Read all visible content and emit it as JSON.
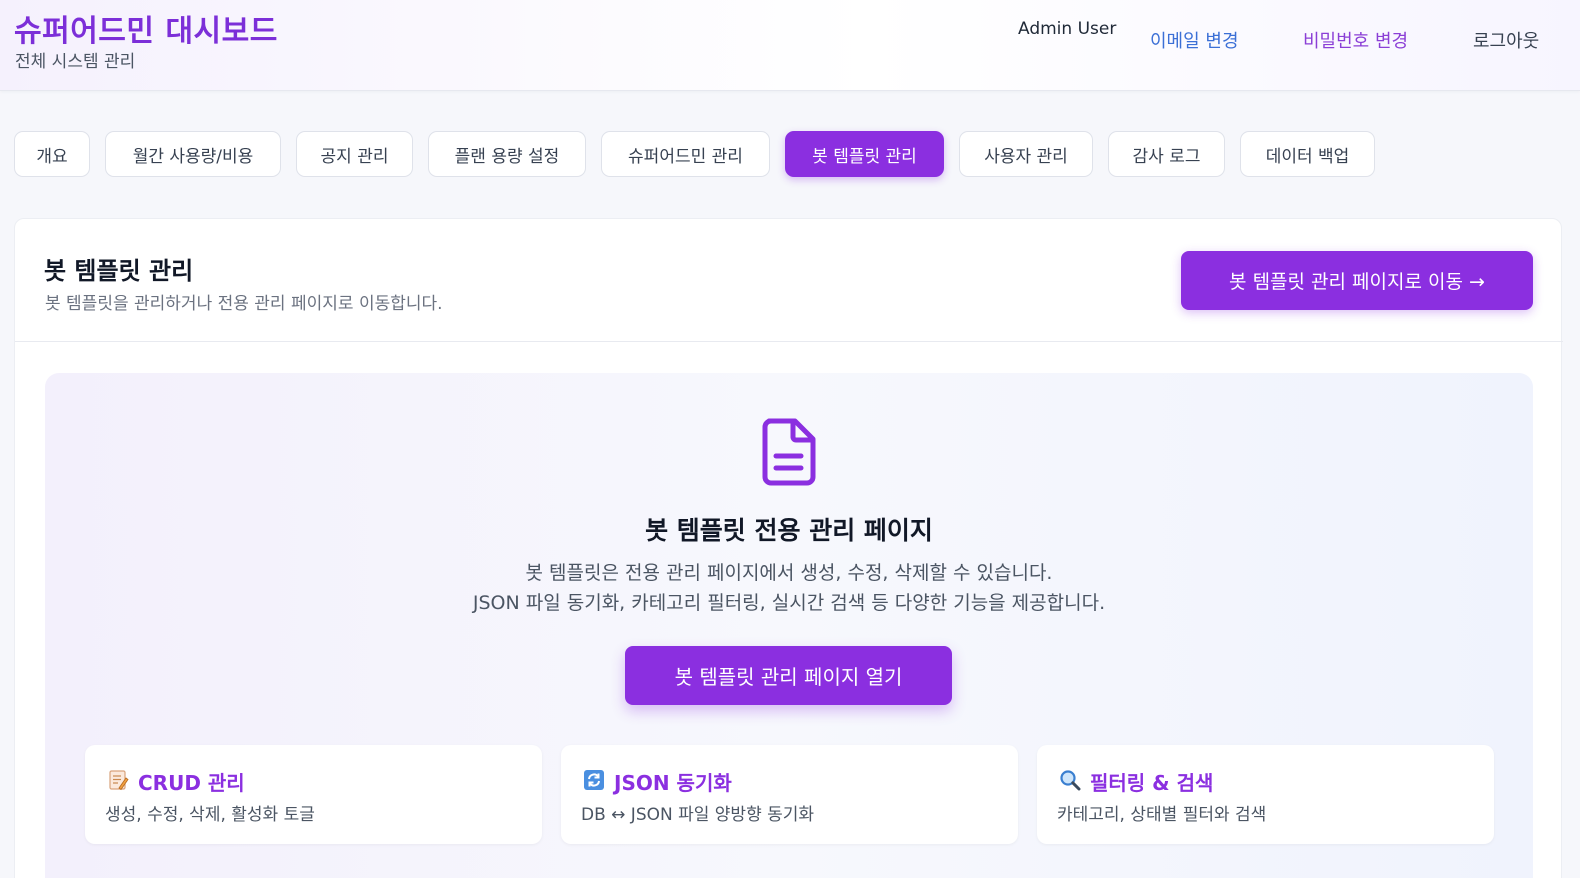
{
  "header": {
    "title": "슈퍼어드민 대시보드",
    "subtitle": "전체 시스템 관리",
    "user_name": "Admin User",
    "links": {
      "change_email": "이메일 변경",
      "change_password": "비밀번호 변경",
      "logout": "로그아웃"
    }
  },
  "tabs": [
    {
      "label": "개요",
      "active": false
    },
    {
      "label": "월간 사용량/비용",
      "active": false
    },
    {
      "label": "공지 관리",
      "active": false
    },
    {
      "label": "플랜 용량 설정",
      "active": false
    },
    {
      "label": "슈퍼어드민 관리",
      "active": false
    },
    {
      "label": "봇 템플릿 관리",
      "active": true
    },
    {
      "label": "사용자 관리",
      "active": false
    },
    {
      "label": "감사 로그",
      "active": false
    },
    {
      "label": "데이터 백업",
      "active": false
    }
  ],
  "section": {
    "title": "봇 템플릿 관리",
    "description": "봇 템플릿을 관리하거나 전용 관리 페이지로 이동합니다.",
    "go_button": "봇 템플릿 관리 페이지로 이동 →"
  },
  "panel": {
    "icon": "document-icon",
    "title": "봇 템플릿 전용 관리 페이지",
    "line1": "봇 템플릿은 전용 관리 페이지에서 생성, 수정, 삭제할 수 있습니다.",
    "line2": "JSON 파일 동기화, 카테고리 필터링, 실시간 검색 등 다양한 기능을 제공합니다.",
    "open_button": "봇 템플릿 관리 페이지 열기"
  },
  "features": [
    {
      "icon": "memo-icon",
      "title": "CRUD 관리",
      "description": "생성, 수정, 삭제, 활성화 토글"
    },
    {
      "icon": "sync-icon",
      "title": "JSON 동기화",
      "description": "DB ↔ JSON 파일 양방향 동기화"
    },
    {
      "icon": "magnifier-icon",
      "title": "필터링 & 검색",
      "description": "카테고리, 상태별 필터와 검색"
    }
  ],
  "colors": {
    "accent": "#8b2fe0",
    "title": "#7c2fd8",
    "email_link": "#3b6fd6",
    "password_link": "#8b3fd6"
  }
}
